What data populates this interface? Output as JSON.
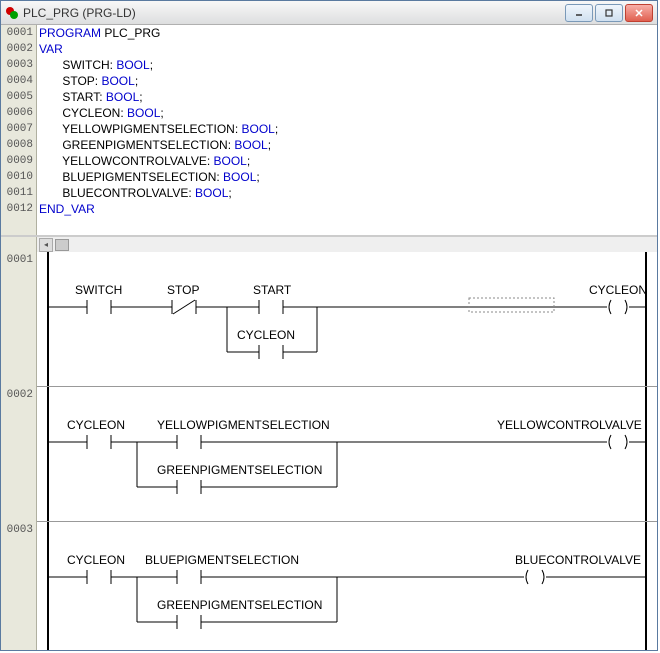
{
  "window": {
    "title": "PLC_PRG (PRG-LD)"
  },
  "code": {
    "lines": [
      {
        "n": "0001",
        "pre": "",
        "kw": "PROGRAM",
        "rest": " PLC_PRG"
      },
      {
        "n": "0002",
        "pre": "",
        "kw": "VAR",
        "rest": ""
      },
      {
        "n": "0003",
        "pre": "       SWITCH: ",
        "kw": "BOOL",
        "rest": ";"
      },
      {
        "n": "0004",
        "pre": "       STOP: ",
        "kw": "BOOL",
        "rest": ";"
      },
      {
        "n": "0005",
        "pre": "       START: ",
        "kw": "BOOL",
        "rest": ";"
      },
      {
        "n": "0006",
        "pre": "       CYCLEON: ",
        "kw": "BOOL",
        "rest": ";"
      },
      {
        "n": "0007",
        "pre": "       YELLOWPIGMENTSELECTION: ",
        "kw": "BOOL",
        "rest": ";"
      },
      {
        "n": "0008",
        "pre": "       GREENPIGMENTSELECTION: ",
        "kw": "BOOL",
        "rest": ";"
      },
      {
        "n": "0009",
        "pre": "       YELLOWCONTROLVALVE: ",
        "kw": "BOOL",
        "rest": ";"
      },
      {
        "n": "0010",
        "pre": "       BLUEPIGMENTSELECTION: ",
        "kw": "BOOL",
        "rest": ";"
      },
      {
        "n": "0011",
        "pre": "       BLUECONTROLVALVE: ",
        "kw": "BOOL",
        "rest": ";"
      },
      {
        "n": "0012",
        "pre": "",
        "kw": "END_VAR",
        "rest": ""
      }
    ]
  },
  "ladder": {
    "networks": [
      "0001",
      "0002",
      "0003"
    ],
    "net1": {
      "c1": "SWITCH",
      "c2": "STOP",
      "c3": "START",
      "c4": "CYCLEON",
      "coil": "CYCLEON"
    },
    "net2": {
      "c1": "CYCLEON",
      "c2": "YELLOWPIGMENTSELECTION",
      "c3": "GREENPIGMENTSELECTION",
      "coil": "YELLOWCONTROLVALVE"
    },
    "net3": {
      "c1": "CYCLEON",
      "c2": "BLUEPIGMENTSELECTION",
      "c3": "GREENPIGMENTSELECTION",
      "coil": "BLUECONTROLVALVE"
    }
  }
}
